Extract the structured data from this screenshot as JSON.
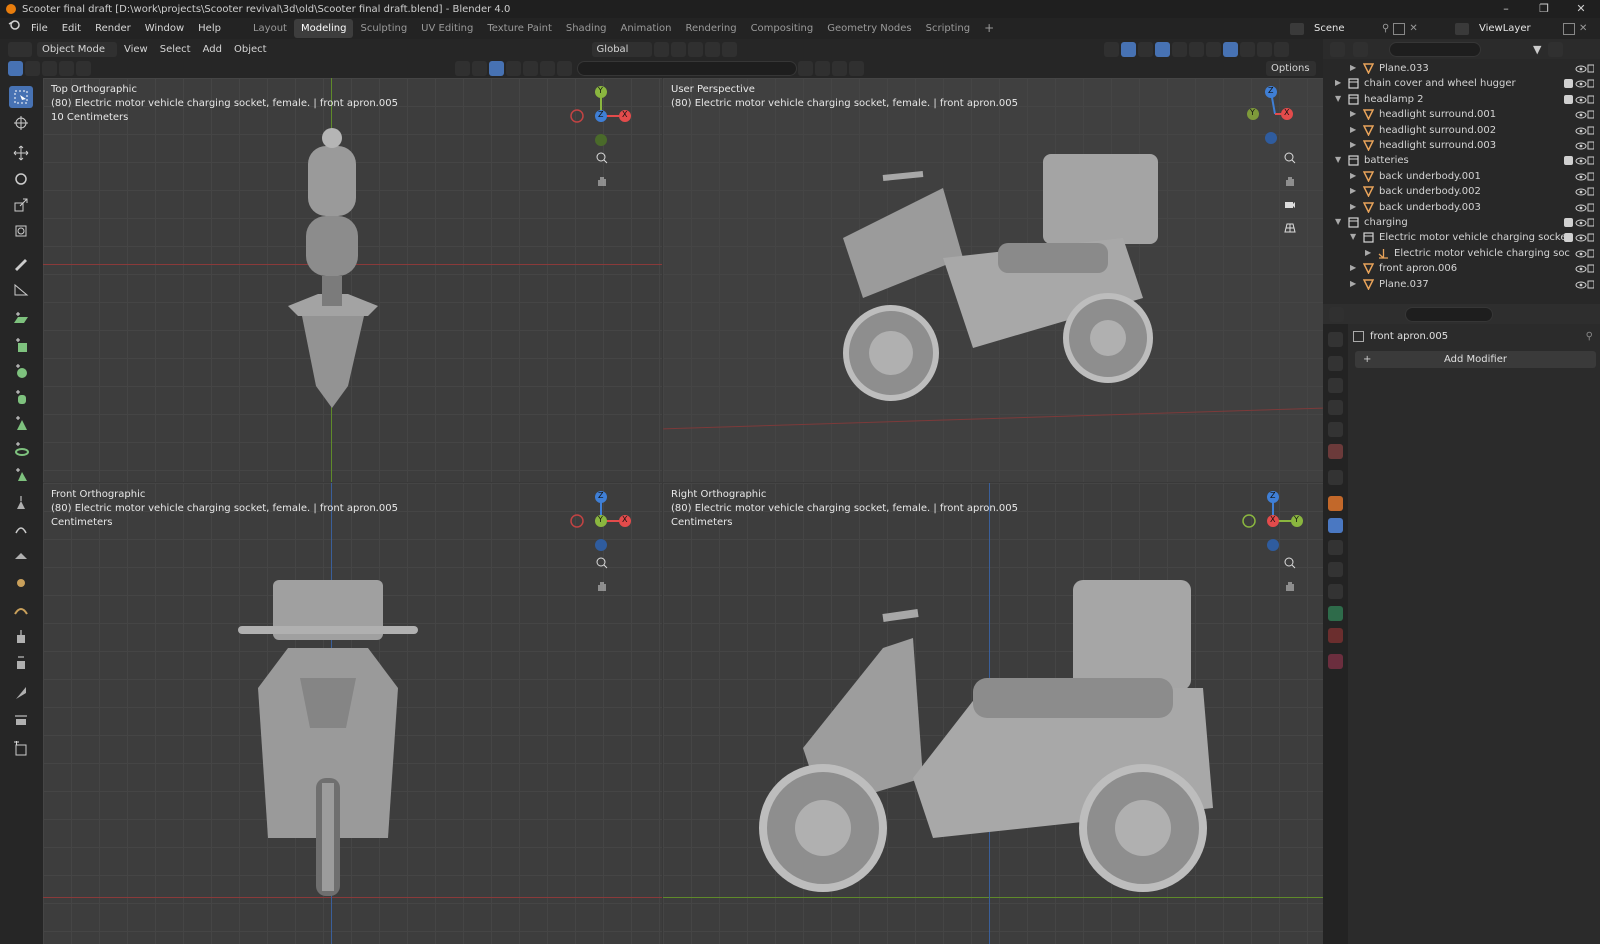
{
  "window": {
    "title": "Scooter final draft [D:\\work\\projects\\Scooter revival\\3d\\old\\Scooter final draft.blend] - Blender 4.0"
  },
  "menu": [
    "File",
    "Edit",
    "Render",
    "Window",
    "Help"
  ],
  "workspaces": [
    {
      "label": "Layout",
      "active": false
    },
    {
      "label": "Modeling",
      "active": true
    },
    {
      "label": "Sculpting",
      "active": false
    },
    {
      "label": "UV Editing",
      "active": false
    },
    {
      "label": "Texture Paint",
      "active": false
    },
    {
      "label": "Shading",
      "active": false
    },
    {
      "label": "Animation",
      "active": false
    },
    {
      "label": "Rendering",
      "active": false
    },
    {
      "label": "Compositing",
      "active": false
    },
    {
      "label": "Geometry Nodes",
      "active": false
    },
    {
      "label": "Scripting",
      "active": false
    }
  ],
  "add_workspace": "+",
  "scene": {
    "name": "Scene"
  },
  "view_layer": {
    "name": "ViewLayer"
  },
  "viewport_header": {
    "mode": "Object Mode",
    "menus": [
      "View",
      "Select",
      "Add",
      "Object"
    ],
    "orientation": "Global",
    "options": "Options"
  },
  "viewports": [
    {
      "name": "Top Orthographic",
      "object": "(80) Electric motor vehicle charging socket, female. | front apron.005",
      "scale": "10 Centimeters",
      "gizmo": [
        "Y",
        "X",
        "Z"
      ]
    },
    {
      "name": "User Perspective",
      "object": "(80) Electric motor vehicle charging socket, female. | front apron.005",
      "scale": "",
      "gizmo": [
        "Z",
        "X",
        "Y"
      ]
    },
    {
      "name": "Front Orthographic",
      "object": "(80) Electric motor vehicle charging socket, female. | front apron.005",
      "scale": "Centimeters",
      "gizmo": [
        "Z",
        "Y",
        "X"
      ]
    },
    {
      "name": "Right Orthographic",
      "object": "(80) Electric motor vehicle charging socket, female. | front apron.005",
      "scale": "Centimeters",
      "gizmo": [
        "Z",
        "X",
        "Y"
      ]
    }
  ],
  "outliner": {
    "rows": [
      {
        "label": "Plane.033",
        "indent": 1,
        "type": "mesh",
        "collapsed": true
      },
      {
        "label": "chain cover and wheel hugger",
        "indent": 0,
        "type": "collection",
        "collapsed": true
      },
      {
        "label": "headlamp 2",
        "indent": 0,
        "type": "collection",
        "collapsed": false
      },
      {
        "label": "headlight surround.001",
        "indent": 1,
        "type": "mesh",
        "collapsed": true
      },
      {
        "label": "headlight surround.002",
        "indent": 1,
        "type": "mesh",
        "collapsed": true
      },
      {
        "label": "headlight surround.003",
        "indent": 1,
        "type": "mesh",
        "collapsed": true
      },
      {
        "label": "batteries",
        "indent": 0,
        "type": "collection",
        "collapsed": false
      },
      {
        "label": "back underbody.001",
        "indent": 1,
        "type": "mesh",
        "collapsed": true
      },
      {
        "label": "back underbody.002",
        "indent": 1,
        "type": "mesh",
        "collapsed": true
      },
      {
        "label": "back underbody.003",
        "indent": 1,
        "type": "mesh",
        "collapsed": true
      },
      {
        "label": "charging",
        "indent": 0,
        "type": "collection",
        "collapsed": false
      },
      {
        "label": "Electric motor vehicle charging socket",
        "indent": 1,
        "type": "collection",
        "collapsed": false
      },
      {
        "label": "Electric motor vehicle charging soc",
        "indent": 2,
        "type": "empty",
        "collapsed": true
      },
      {
        "label": "front apron.006",
        "indent": 1,
        "type": "mesh",
        "collapsed": true
      },
      {
        "label": "Plane.037",
        "indent": 1,
        "type": "mesh",
        "collapsed": true
      }
    ]
  },
  "properties": {
    "object_name": "front apron.005",
    "add_modifier": "Add Modifier",
    "plus": "+"
  }
}
